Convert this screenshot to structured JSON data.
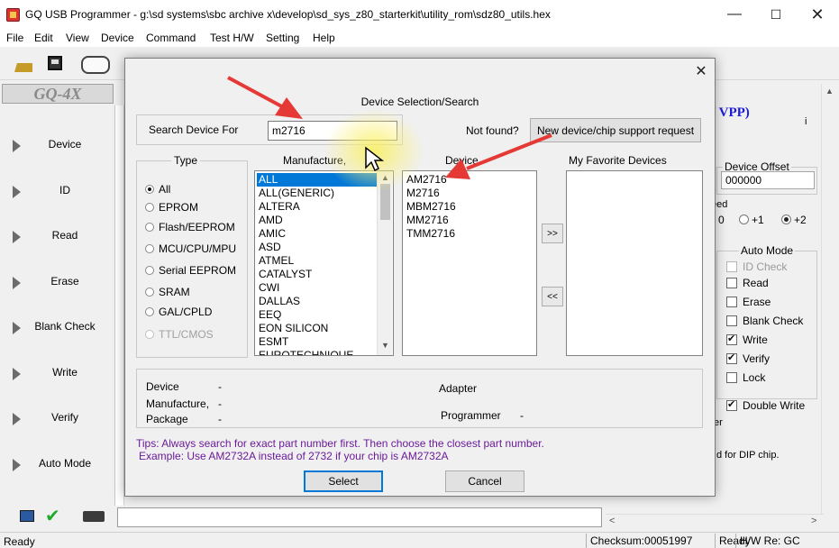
{
  "window": {
    "title": "GQ USB Programmer - g:\\sd systems\\sbc archive x\\develop\\sd_sys_z80_starterkit\\utility_rom\\sdz80_utils.hex",
    "min": "—",
    "max": "☐",
    "close": "✕"
  },
  "menu": [
    "File",
    "Edit",
    "View",
    "Device",
    "Command",
    "Test H/W",
    "Setting",
    "Help"
  ],
  "logo": "GQ-4X",
  "sidebar": [
    {
      "label": "Device"
    },
    {
      "label": "ID"
    },
    {
      "label": "Read"
    },
    {
      "label": "Erase"
    },
    {
      "label": "Blank Check"
    },
    {
      "label": "Write"
    },
    {
      "label": "Verify"
    },
    {
      "label": "Auto Mode"
    }
  ],
  "right_panel": {
    "vpp": "/ VPP)",
    "i_mark": "i",
    "offset_title": "Device Offset",
    "offset_value": "000000",
    "speed_label": "eed",
    "speed_opts": [
      "0",
      "+1",
      "+2"
    ],
    "speed_selected": "+2",
    "auto_title": "Auto Mode",
    "auto_items": [
      {
        "label": "ID Check",
        "checked": false,
        "enabled": false
      },
      {
        "label": "Read",
        "checked": false,
        "enabled": true
      },
      {
        "label": "Erase",
        "checked": false,
        "enabled": true
      },
      {
        "label": "Blank Check",
        "checked": false,
        "enabled": true
      },
      {
        "label": "Write",
        "checked": true,
        "enabled": true
      },
      {
        "label": "Verify",
        "checked": true,
        "enabled": true
      },
      {
        "label": "Lock",
        "checked": false,
        "enabled": true
      }
    ],
    "double_write": "Double Write",
    "filter_label": "ter",
    "dip_hint": "d for DIP chip."
  },
  "statusbar": {
    "ready": "Ready",
    "checksum": "Checksum:00051997",
    "ready2": "Ready",
    "hw_rev": "H/W Re: GC"
  },
  "dialog": {
    "close": "✕",
    "title": "Device Selection/Search",
    "search_label": "Search Device For",
    "search_value": "m2716",
    "not_found": "Not found?",
    "new_request": "New device/chip support request",
    "type_label": "Type",
    "manufacture_label": "Manufacture,",
    "device_label": "Device",
    "favorites_label": "My Favorite Devices",
    "types": [
      {
        "label": "All",
        "selected": true,
        "enabled": true
      },
      {
        "label": "EPROM",
        "selected": false,
        "enabled": true
      },
      {
        "label": "Flash/EEPROM",
        "selected": false,
        "enabled": true
      },
      {
        "label": "MCU/CPU/MPU",
        "selected": false,
        "enabled": true
      },
      {
        "label": "Serial EEPROM",
        "selected": false,
        "enabled": true
      },
      {
        "label": "SRAM",
        "selected": false,
        "enabled": true
      },
      {
        "label": "GAL/CPLD",
        "selected": false,
        "enabled": true
      },
      {
        "label": "TTL/CMOS",
        "selected": false,
        "enabled": false
      }
    ],
    "manufacturers": [
      "ALL",
      "ALL(GENERIC)",
      "ALTERA",
      "AMD",
      "AMIC",
      "ASD",
      "ATMEL",
      "CATALYST",
      "CWI",
      "DALLAS",
      "EEQ",
      "EON SILICON",
      "ESMT",
      "EUROTECHNIQUE"
    ],
    "manufacturer_selected": "ALL",
    "devices": [
      "AM2716",
      "M2716",
      "MBM2716",
      "MM2716",
      "TMM2716"
    ],
    "add_fav": ">>",
    "remove_fav": "<<",
    "info": {
      "device_label": "Device",
      "device_value": "-",
      "manufacture_label": "Manufacture,",
      "manufacture_value": "-",
      "package_label": "Package",
      "package_value": "-",
      "adapter_label": "Adapter",
      "programmer_label": "Programmer",
      "programmer_value": "-"
    },
    "tips_line1": "Tips: Always search for exact part number first. Then choose the closest part number.",
    "tips_line2": "Example: Use AM2732A instead of 2732 if your chip is AM2732A",
    "select": "Select",
    "cancel": "Cancel"
  },
  "colors": {
    "accent": "#0078d7",
    "annotation": "#e53935",
    "tips": "#6a1b9a",
    "vpp": "#1b1bd8"
  }
}
